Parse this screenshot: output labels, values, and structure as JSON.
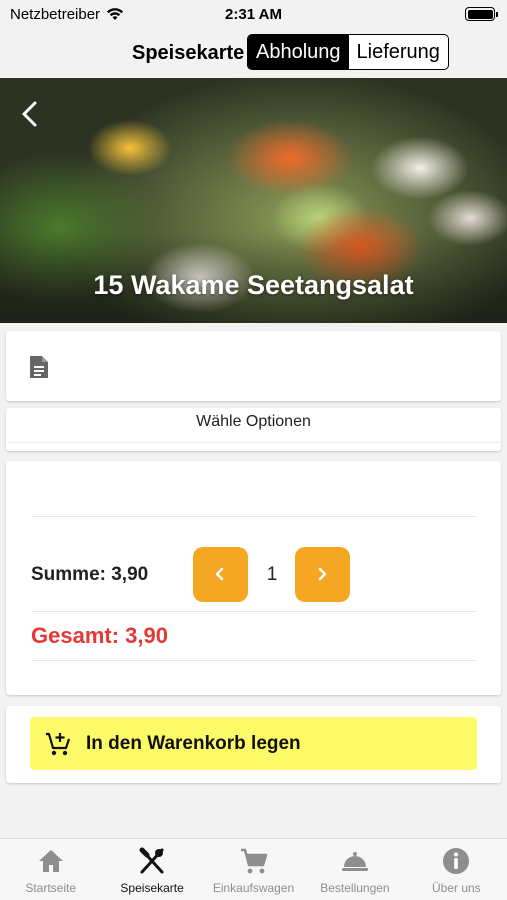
{
  "status_bar": {
    "carrier": "Netzbetreiber",
    "time": "2:31 AM"
  },
  "header": {
    "title": "Speisekarte",
    "segments": [
      "Abholung",
      "Lieferung"
    ],
    "active_segment": "Abholung"
  },
  "hero": {
    "item_title": "15 Wakame Seetangsalat"
  },
  "options": {
    "label": "Wähle Optionen"
  },
  "summary": {
    "sum_label": "Summe: 3,90",
    "quantity": "1",
    "total_label": "Gesamt: 3,90"
  },
  "cart": {
    "add_label": "In den Warenkorb legen"
  },
  "tabs": [
    {
      "label": "Startseite",
      "icon": "home-icon"
    },
    {
      "label": "Speisekarte",
      "icon": "utensils-icon"
    },
    {
      "label": "Einkaufswagen",
      "icon": "cart-icon"
    },
    {
      "label": "Bestellungen",
      "icon": "cloche-icon"
    },
    {
      "label": "Über uns",
      "icon": "info-icon"
    }
  ],
  "active_tab": "Speisekarte",
  "colors": {
    "accent_orange": "#f5a623",
    "total_red": "#e53935",
    "cart_button_yellow": "#fdfa6a",
    "segment_active": "#000000"
  }
}
